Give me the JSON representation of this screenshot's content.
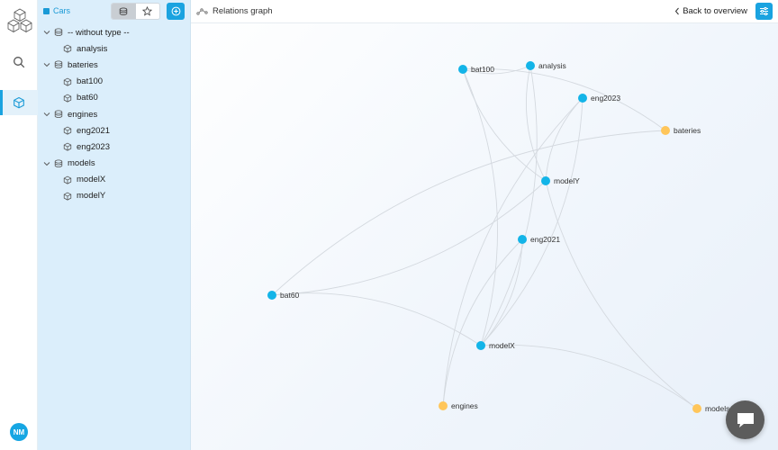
{
  "rail": {
    "avatar_initials": "NM"
  },
  "tree": {
    "project_name": "Cars",
    "groups": [
      {
        "label": "-- without type --",
        "items": [
          "analysis"
        ]
      },
      {
        "label": "bateries",
        "items": [
          "bat100",
          "bat60"
        ]
      },
      {
        "label": "engines",
        "items": [
          "eng2021",
          "eng2023"
        ]
      },
      {
        "label": "models",
        "items": [
          "modelX",
          "modelY"
        ]
      }
    ]
  },
  "topbar": {
    "title": "Relations graph",
    "back_label": "Back to overview"
  },
  "graph": {
    "colors": {
      "model_node": "#13b4e8",
      "type_node": "#ffc65a",
      "edge": "#d4d9df"
    },
    "nodes": [
      {
        "id": "bat100",
        "label": "bat100",
        "kind": "model"
      },
      {
        "id": "analysis",
        "label": "analysis",
        "kind": "model"
      },
      {
        "id": "eng2023",
        "label": "eng2023",
        "kind": "model"
      },
      {
        "id": "bateries",
        "label": "bateries",
        "kind": "type"
      },
      {
        "id": "modelY",
        "label": "modelY",
        "kind": "model"
      },
      {
        "id": "eng2021",
        "label": "eng2021",
        "kind": "model"
      },
      {
        "id": "bat60",
        "label": "bat60",
        "kind": "model"
      },
      {
        "id": "modelX",
        "label": "modelX",
        "kind": "model"
      },
      {
        "id": "engines",
        "label": "engines",
        "kind": "type"
      },
      {
        "id": "models",
        "label": "models",
        "kind": "type"
      }
    ],
    "edges": [
      [
        "bat100",
        "analysis"
      ],
      [
        "bat100",
        "bateries"
      ],
      [
        "bat100",
        "modelY"
      ],
      [
        "bat100",
        "modelX"
      ],
      [
        "analysis",
        "modelY"
      ],
      [
        "analysis",
        "modelX"
      ],
      [
        "eng2023",
        "modelY"
      ],
      [
        "eng2023",
        "modelX"
      ],
      [
        "eng2023",
        "engines"
      ],
      [
        "bat60",
        "bateries"
      ],
      [
        "bat60",
        "modelY"
      ],
      [
        "bat60",
        "modelX"
      ],
      [
        "modelY",
        "models"
      ],
      [
        "eng2021",
        "modelX"
      ],
      [
        "eng2021",
        "engines"
      ],
      [
        "modelX",
        "models"
      ]
    ]
  }
}
